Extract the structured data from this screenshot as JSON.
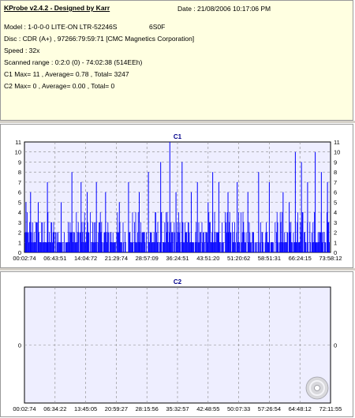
{
  "info": {
    "title": "KProbe v2.4.2 - Designed by Karr",
    "date": "Date : 21/08/2006 10:17:06 PM",
    "model": "Model : 1-0-0-0 LITE-ON LTR-52246S",
    "firmware": "6S0F",
    "disc": "Disc : CDR (A+) , 97266:79:59:71 [CMC Magnetics Corporation]",
    "speed": "Speed : 32x",
    "range": "Scanned range : 0:2:0 (0) - 74:02:38 (514EEh)",
    "c1": "C1 Max= 11 , Average= 0.78 , Total= 3247",
    "c2": "C2 Max= 0 , Average= 0.00 , Total= 0"
  },
  "colors": {
    "plot_bg": "#eeeeff",
    "bar": "#0000ff",
    "title": "#00008b"
  },
  "icon": "cd-disc-icon",
  "chart_data": [
    {
      "type": "bar",
      "title": "C1",
      "ylim": [
        0,
        11
      ],
      "yticks": [
        "0",
        "1",
        "2",
        "3",
        "4",
        "5",
        "6",
        "7",
        "8",
        "9",
        "10",
        "11"
      ],
      "xticks": [
        "00:02:74",
        "06:43:51",
        "14:04:72",
        "21:29:74",
        "28:57:09",
        "36:24:51",
        "43:51:20",
        "51:20:62",
        "58:51:31",
        "66:24:15",
        "73:58:12"
      ],
      "grid": true,
      "spikes": [
        {
          "t": 0.005,
          "v": 5
        },
        {
          "t": 0.02,
          "v": 6
        },
        {
          "t": 0.045,
          "v": 5
        },
        {
          "t": 0.075,
          "v": 7
        },
        {
          "t": 0.12,
          "v": 5
        },
        {
          "t": 0.155,
          "v": 8
        },
        {
          "t": 0.185,
          "v": 7
        },
        {
          "t": 0.205,
          "v": 6
        },
        {
          "t": 0.235,
          "v": 7
        },
        {
          "t": 0.265,
          "v": 6
        },
        {
          "t": 0.31,
          "v": 5
        },
        {
          "t": 0.34,
          "v": 7
        },
        {
          "t": 0.375,
          "v": 6
        },
        {
          "t": 0.405,
          "v": 8
        },
        {
          "t": 0.445,
          "v": 9
        },
        {
          "t": 0.475,
          "v": 11
        },
        {
          "t": 0.495,
          "v": 6
        },
        {
          "t": 0.515,
          "v": 9
        },
        {
          "t": 0.545,
          "v": 6
        },
        {
          "t": 0.565,
          "v": 7
        },
        {
          "t": 0.6,
          "v": 5
        },
        {
          "t": 0.615,
          "v": 8
        },
        {
          "t": 0.635,
          "v": 7
        },
        {
          "t": 0.665,
          "v": 6
        },
        {
          "t": 0.695,
          "v": 7
        },
        {
          "t": 0.73,
          "v": 6
        },
        {
          "t": 0.765,
          "v": 8
        },
        {
          "t": 0.8,
          "v": 7
        },
        {
          "t": 0.845,
          "v": 6
        },
        {
          "t": 0.865,
          "v": 5
        },
        {
          "t": 0.885,
          "v": 10
        },
        {
          "t": 0.905,
          "v": 9
        },
        {
          "t": 0.925,
          "v": 7
        },
        {
          "t": 0.95,
          "v": 10
        },
        {
          "t": 0.97,
          "v": 8
        },
        {
          "t": 0.99,
          "v": 7
        }
      ]
    },
    {
      "type": "bar",
      "title": "C2",
      "ylim": [
        0,
        0
      ],
      "yticks": [
        "0"
      ],
      "xticks": [
        "00:02:74",
        "06:34:22",
        "13:45:05",
        "20:59:27",
        "28:15:56",
        "35:32:57",
        "42:48:55",
        "50:07:33",
        "57:26:54",
        "64:48:12",
        "72:11:55"
      ],
      "grid": true,
      "values": []
    }
  ]
}
